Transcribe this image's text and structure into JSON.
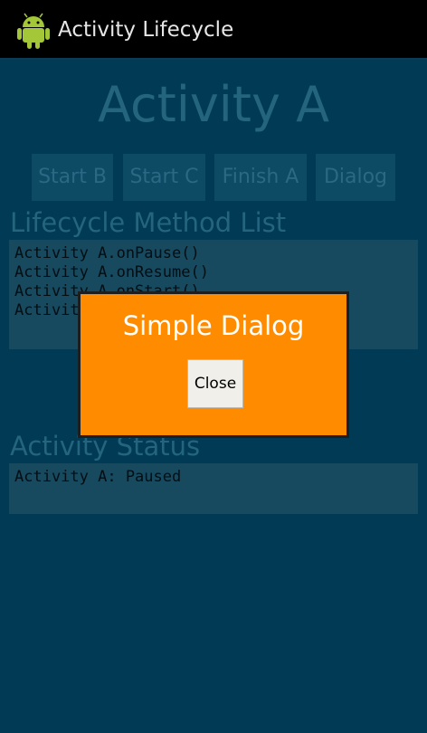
{
  "titlebar": {
    "app_title": "Activity Lifecycle",
    "icon": "android-robot-icon"
  },
  "main": {
    "activity_title": "Activity A",
    "buttons": [
      {
        "label": "Start B"
      },
      {
        "label": "Start C"
      },
      {
        "label": "Finish A"
      },
      {
        "label": "Dialog"
      }
    ],
    "lifecycle_label": "Lifecycle Method List",
    "lifecycle_items": [
      "Activity A.onPause()",
      "Activity A.onResume()",
      "Activity A.onStart()",
      "Activity A.onCreate()"
    ],
    "status_label": "Activity Status",
    "status_text": "Activity A: Paused"
  },
  "dialog": {
    "title": "Simple Dialog",
    "close_label": "Close"
  },
  "colors": {
    "background": "#013a54",
    "dialog": "#ff8c00",
    "titlebar": "#000000"
  }
}
